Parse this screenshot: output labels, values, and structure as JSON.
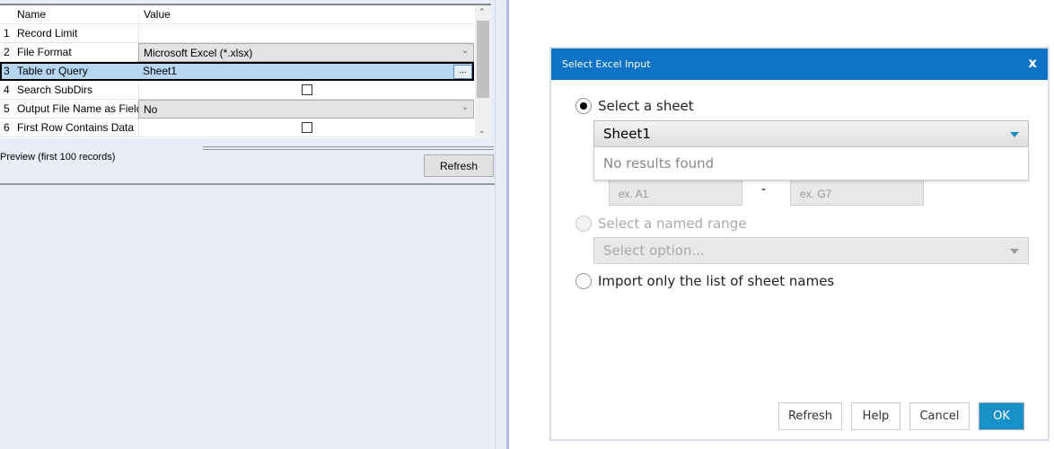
{
  "grid": {
    "headers": {
      "name": "Name",
      "value": "Value"
    },
    "rows": [
      {
        "num": "1",
        "name": "Record Limit",
        "value": ""
      },
      {
        "num": "2",
        "name": "File Format",
        "value": "Microsoft Excel (*.xlsx)"
      },
      {
        "num": "3",
        "name": "Table or Query",
        "value": "Sheet1",
        "button": "..."
      },
      {
        "num": "4",
        "name": "Search SubDirs",
        "checked": false
      },
      {
        "num": "5",
        "name": "Output File Name as Field",
        "value": "No"
      },
      {
        "num": "6",
        "name": "First Row Contains Data",
        "checked": false
      }
    ]
  },
  "preview": {
    "label": "Preview (first 100 records)",
    "refresh": "Refresh"
  },
  "dialog": {
    "title": "Select Excel Input",
    "close": "x",
    "option_sheet": "Select a sheet",
    "sheet_value": "Sheet1",
    "no_results": "No results found",
    "range_start_placeholder": "ex. A1",
    "range_sep": "-",
    "range_end_placeholder": "ex. G7",
    "option_named_range": "Select a named range",
    "named_range_placeholder": "Select option...",
    "option_sheet_names": "Import only the list of sheet names",
    "buttons": {
      "refresh": "Refresh",
      "help": "Help",
      "cancel": "Cancel",
      "ok": "OK"
    }
  },
  "colors": {
    "accent": "#0e72c6",
    "ok": "#1890c8",
    "selected_row": "#b6d6f2"
  }
}
